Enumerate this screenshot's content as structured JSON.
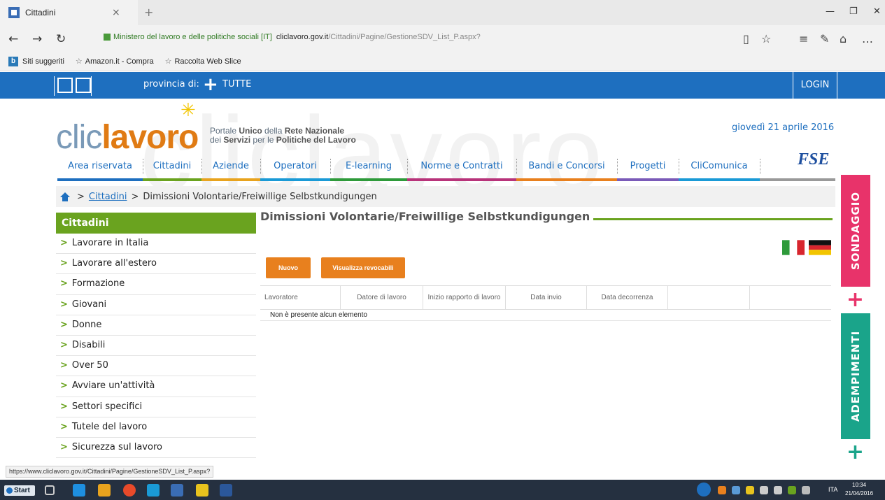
{
  "browser": {
    "tab_title": "Cittadini",
    "tab_close": "×",
    "new_tab": "+",
    "site_identity": "Ministero del lavoro e delle politiche sociali [IT]",
    "url_domain": "cliclavoro.gov.it",
    "url_path": "/Cittadini/Pagine/GestioneSDV_List_P.aspx?",
    "favorites": [
      "Siti suggeriti",
      "Amazon.it - Compra",
      "Raccolta Web Slice"
    ],
    "status_url": "https://www.cliclavoro.gov.it/Cittadini/Pagine/GestioneSDV_List_P.aspx?"
  },
  "topbar": {
    "province_label": "provincia di:",
    "province_value": "TUTTE",
    "login": "LOGIN"
  },
  "header": {
    "logo_part1": "clic",
    "logo_part2": "lavoro",
    "tagline_1a": "Portale ",
    "tagline_1b": "Unico",
    "tagline_1c": " della ",
    "tagline_1d": "Rete Nazionale",
    "tagline_2a": "dei ",
    "tagline_2b": "Servizi",
    "tagline_2c": " per le ",
    "tagline_2d": "Politiche del Lavoro",
    "date": "giovedì 21 aprile 2016",
    "fse": "FSE",
    "watermark": "cliclavoro"
  },
  "menu": [
    {
      "label": "Area riservata",
      "color": "#1e6fbf"
    },
    {
      "label": "Cittadini",
      "color": "#6aa31f"
    },
    {
      "label": "Aziende",
      "color": "#e8a31e"
    },
    {
      "label": "Operatori",
      "color": "#1a9ad6"
    },
    {
      "label": "E-learning",
      "color": "#2e9a3a"
    },
    {
      "label": "Norme e Contratti",
      "color": "#b8337a"
    },
    {
      "label": "Bandi e Concorsi",
      "color": "#e8801e"
    },
    {
      "label": "Progetti",
      "color": "#7a5ab8"
    },
    {
      "label": "CliComunica",
      "color": "#1a9ad6"
    },
    {
      "label": "",
      "color": "#999999"
    }
  ],
  "breadcrumb": {
    "sep": ">",
    "link": "Cittadini",
    "current": "Dimissioni Volontarie/Freiwillige Selbstkundigungen"
  },
  "sidebar": {
    "title": "Cittadini",
    "items": [
      "Lavorare in Italia",
      "Lavorare all'estero",
      "Formazione",
      "Giovani",
      "Donne",
      "Disabili",
      "Over 50",
      "Avviare un'attività",
      "Settori specifici",
      "Tutele del lavoro",
      "Sicurezza sul lavoro"
    ]
  },
  "main": {
    "title": "Dimissioni Volontarie/Freiwillige Selbstkundigungen",
    "btn_new": "Nuovo",
    "btn_revocable": "Visualizza revocabili",
    "columns": [
      "Lavoratore",
      "Datore di lavoro",
      "Inizio rapporto di lavoro",
      "Data invio",
      "Data decorrenza",
      "",
      ""
    ],
    "empty": "Non è presente alcun elemento"
  },
  "right_tabs": {
    "sondaggio": "SONDAGGIO",
    "adempimenti": "ADEMPIMENTI",
    "plus": "+",
    "sondaggio_color": "#e8336a",
    "adempimenti_color": "#1aa48a"
  },
  "taskbar": {
    "start": "Start",
    "lang": "ITA",
    "time": "10:34",
    "date": "21/04/2016"
  }
}
